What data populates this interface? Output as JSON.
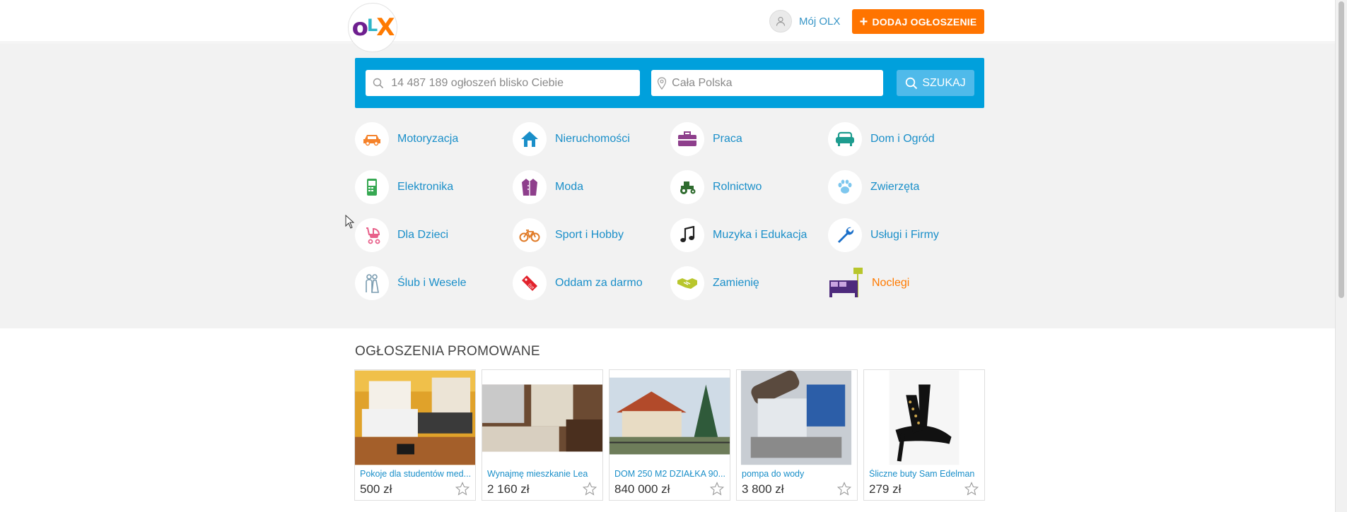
{
  "header": {
    "logo_text": "OLX",
    "my_olx_label": "Mój OLX",
    "add_button_label": "DODAJ OGŁOSZENIE"
  },
  "search": {
    "query_placeholder": "14 487 189 ogłoszeń blisko Ciebie",
    "location_placeholder": "Cała Polska",
    "button_label": "SZUKAJ"
  },
  "categories": [
    {
      "label": "Motoryzacja",
      "icon": "car-icon",
      "color": "#f5822a"
    },
    {
      "label": "Nieruchomości",
      "icon": "house-icon",
      "color": "#1a8fc9"
    },
    {
      "label": "Praca",
      "icon": "briefcase-icon",
      "color": "#8e3f8c"
    },
    {
      "label": "Dom i Ogród",
      "icon": "sofa-icon",
      "color": "#1d9c8f"
    },
    {
      "label": "Elektronika",
      "icon": "phone-icon",
      "color": "#36a852"
    },
    {
      "label": "Moda",
      "icon": "jacket-icon",
      "color": "#8e3f8c"
    },
    {
      "label": "Rolnictwo",
      "icon": "tractor-icon",
      "color": "#2e6b2e"
    },
    {
      "label": "Zwierzęta",
      "icon": "paw-icon",
      "color": "#7ec7ee"
    },
    {
      "label": "Dla Dzieci",
      "icon": "stroller-icon",
      "color": "#e8608a"
    },
    {
      "label": "Sport i Hobby",
      "icon": "bicycle-icon",
      "color": "#e07b28"
    },
    {
      "label": "Muzyka i Edukacja",
      "icon": "music-note-icon",
      "color": "#222222"
    },
    {
      "label": "Usługi i Firmy",
      "icon": "wrench-icon",
      "color": "#1a6fc9"
    },
    {
      "label": "Ślub i Wesele",
      "icon": "couple-icon",
      "color": "#7a9cb0"
    },
    {
      "label": "Oddam za darmo",
      "icon": "price-tag-icon",
      "color": "#e2222c"
    },
    {
      "label": "Zamienię",
      "icon": "handshake-icon",
      "color": "#b8c62c"
    },
    {
      "label": "Noclegi",
      "icon": "bed-icon",
      "color": "#ff7a00",
      "highlight": true
    }
  ],
  "promoted": {
    "title": "OGŁOSZENIA PROMOWANE",
    "items": [
      {
        "title": "Pokoje dla studentów med...",
        "price": "500 zł"
      },
      {
        "title": "Wynajmę mieszkanie Lea",
        "price": "2 160 zł"
      },
      {
        "title": "DOM 250 M2 DZIAŁKA 90...",
        "price": "840 000 zł"
      },
      {
        "title": "pompa do wody",
        "price": "3 800 zł"
      },
      {
        "title": "Śliczne buty Sam Edelman",
        "price": "279 zł"
      }
    ]
  },
  "colors": {
    "accent_orange": "#ff7400",
    "search_blue": "#00a0dc",
    "link_blue": "#1a8fc9"
  }
}
